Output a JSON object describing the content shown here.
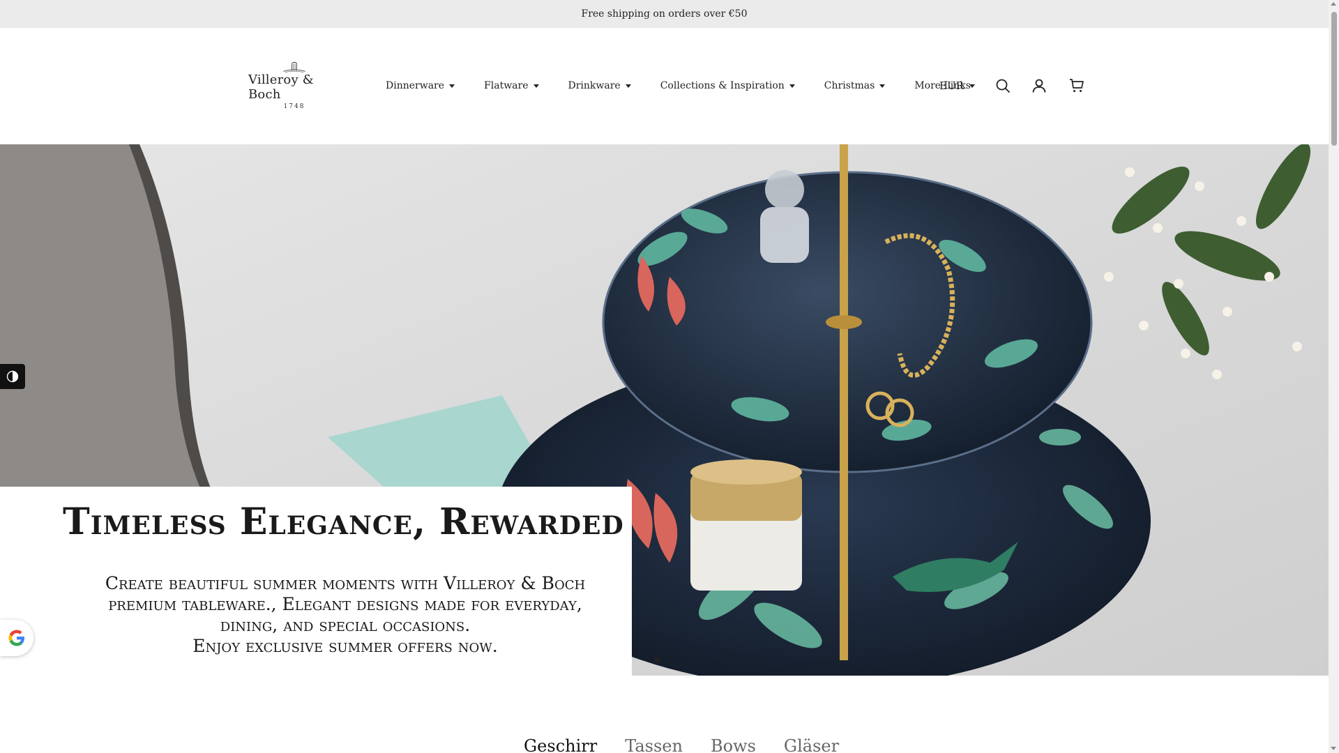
{
  "announcement": {
    "text": "Free shipping on orders over €50"
  },
  "logo": {
    "name": "Villeroy & Boch",
    "year": "1748",
    "icon": "hat-crest-icon"
  },
  "nav": {
    "items": [
      {
        "label": "Dinnerware",
        "has_dropdown": true
      },
      {
        "label": "Flatware",
        "has_dropdown": true
      },
      {
        "label": "Drinkware",
        "has_dropdown": true
      },
      {
        "label": "Collections & Inspiration",
        "has_dropdown": true
      },
      {
        "label": "Christmas",
        "has_dropdown": true
      },
      {
        "label": "More Links",
        "has_dropdown": false
      }
    ]
  },
  "header": {
    "currency": "EUR",
    "icons": [
      "search-icon",
      "account-icon",
      "cart-icon"
    ]
  },
  "hero": {
    "title": "Timeless Elegance, Rewarded",
    "text_lines": [
      "Create beautiful summer moments with Villeroy & Boch",
      "premium tableware.,  Elegant designs made for everyday,",
      "dining,  and special occasions.",
      "Enjoy exclusive summer offers now."
    ],
    "slides": {
      "count": 2,
      "active_index": 0
    }
  },
  "widgets": {
    "accessibility_icon": "accessibility-icon",
    "google_icon": "google-g-icon"
  },
  "category_tabs": [
    {
      "label": "Geschirr",
      "active": true
    },
    {
      "label": "Tassen",
      "active": false
    },
    {
      "label": "Bows",
      "active": false
    },
    {
      "label": "Gläser",
      "active": false
    }
  ],
  "colors": {
    "announcement_bg": "#ebebeb",
    "text": "#222222",
    "plate_navy": "#1c2a3d",
    "gold": "#c9a24a"
  }
}
